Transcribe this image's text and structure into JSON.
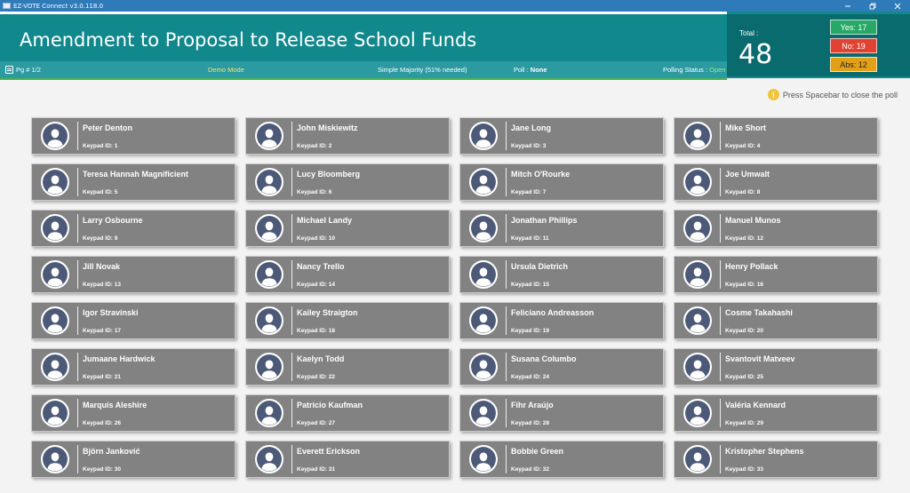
{
  "window": {
    "title": "EZ-VOTE Connect v3.0.118.0"
  },
  "header": {
    "motion_title": "Amendment to Proposal to Release School Funds",
    "page": "Pg # 1/2",
    "mode": "Demo Mode",
    "majority": "Simple Majority (51% needed)",
    "poll_label": "Poll :",
    "poll_value": "None",
    "status_label": "Polling Status :",
    "status_value": "Open"
  },
  "totals": {
    "total_label": "Total :",
    "total_value": "48",
    "yes": "Yes: 17",
    "no": "No: 19",
    "abs": "Abs: 12"
  },
  "hint": {
    "text": "Press Spacebar to close the poll",
    "icon": "info-icon"
  },
  "colors": {
    "header": "#11888c",
    "yes": "#27a866",
    "no": "#e24232",
    "abs": "#e2a018",
    "card": "#828282"
  },
  "delegates": [
    {
      "name": "Peter Denton",
      "keypad": "Keypad ID: 1"
    },
    {
      "name": "John Miskiewitz",
      "keypad": "Keypad ID: 2"
    },
    {
      "name": "Jane Long",
      "keypad": "Keypad ID: 3"
    },
    {
      "name": "Mike Short",
      "keypad": "Keypad ID: 4"
    },
    {
      "name": "Teresa Hannah Magnificient",
      "keypad": "Keypad ID: 5"
    },
    {
      "name": "Lucy Bloomberg",
      "keypad": "Keypad ID: 6"
    },
    {
      "name": "Mitch O'Rourke",
      "keypad": "Keypad ID: 7"
    },
    {
      "name": "Joe Umwalt",
      "keypad": "Keypad ID: 8"
    },
    {
      "name": "Larry Osbourne",
      "keypad": "Keypad ID: 9"
    },
    {
      "name": "Michael Landy",
      "keypad": "Keypad ID: 10"
    },
    {
      "name": "Jonathan Phillips",
      "keypad": "Keypad ID: 11"
    },
    {
      "name": "Manuel Munos",
      "keypad": "Keypad ID: 12"
    },
    {
      "name": "Jill Novak",
      "keypad": "Keypad ID: 13"
    },
    {
      "name": "Nancy Trello",
      "keypad": "Keypad ID: 14"
    },
    {
      "name": "Ursula Dietrich",
      "keypad": "Keypad ID: 15"
    },
    {
      "name": "Henry Pollack",
      "keypad": "Keypad ID: 16"
    },
    {
      "name": "Igor Stravinski",
      "keypad": "Keypad ID: 17"
    },
    {
      "name": "Kailey Straigton",
      "keypad": "Keypad ID: 18"
    },
    {
      "name": "Feliciano Andreasson",
      "keypad": "Keypad ID: 19"
    },
    {
      "name": "Cosme Takahashi",
      "keypad": "Keypad ID: 20"
    },
    {
      "name": "Jumaane Hardwick",
      "keypad": "Keypad ID: 21"
    },
    {
      "name": "Kaelyn Todd",
      "keypad": "Keypad ID: 22"
    },
    {
      "name": "Susana Columbo",
      "keypad": "Keypad ID: 24"
    },
    {
      "name": "Svantovit Matveev",
      "keypad": "Keypad ID: 25"
    },
    {
      "name": "Marquis Aleshire",
      "keypad": "Keypad ID: 26"
    },
    {
      "name": "Patricio Kaufman",
      "keypad": "Keypad ID: 27"
    },
    {
      "name": "Fihr Araújo",
      "keypad": "Keypad ID: 28"
    },
    {
      "name": "Valéria Kennard",
      "keypad": "Keypad ID: 29"
    },
    {
      "name": "Björn Janković",
      "keypad": "Keypad ID: 30"
    },
    {
      "name": "Everett Erickson",
      "keypad": "Keypad ID: 31"
    },
    {
      "name": "Bobbie Green",
      "keypad": "Keypad ID: 32"
    },
    {
      "name": "Kristopher Stephens",
      "keypad": "Keypad ID: 33"
    }
  ]
}
